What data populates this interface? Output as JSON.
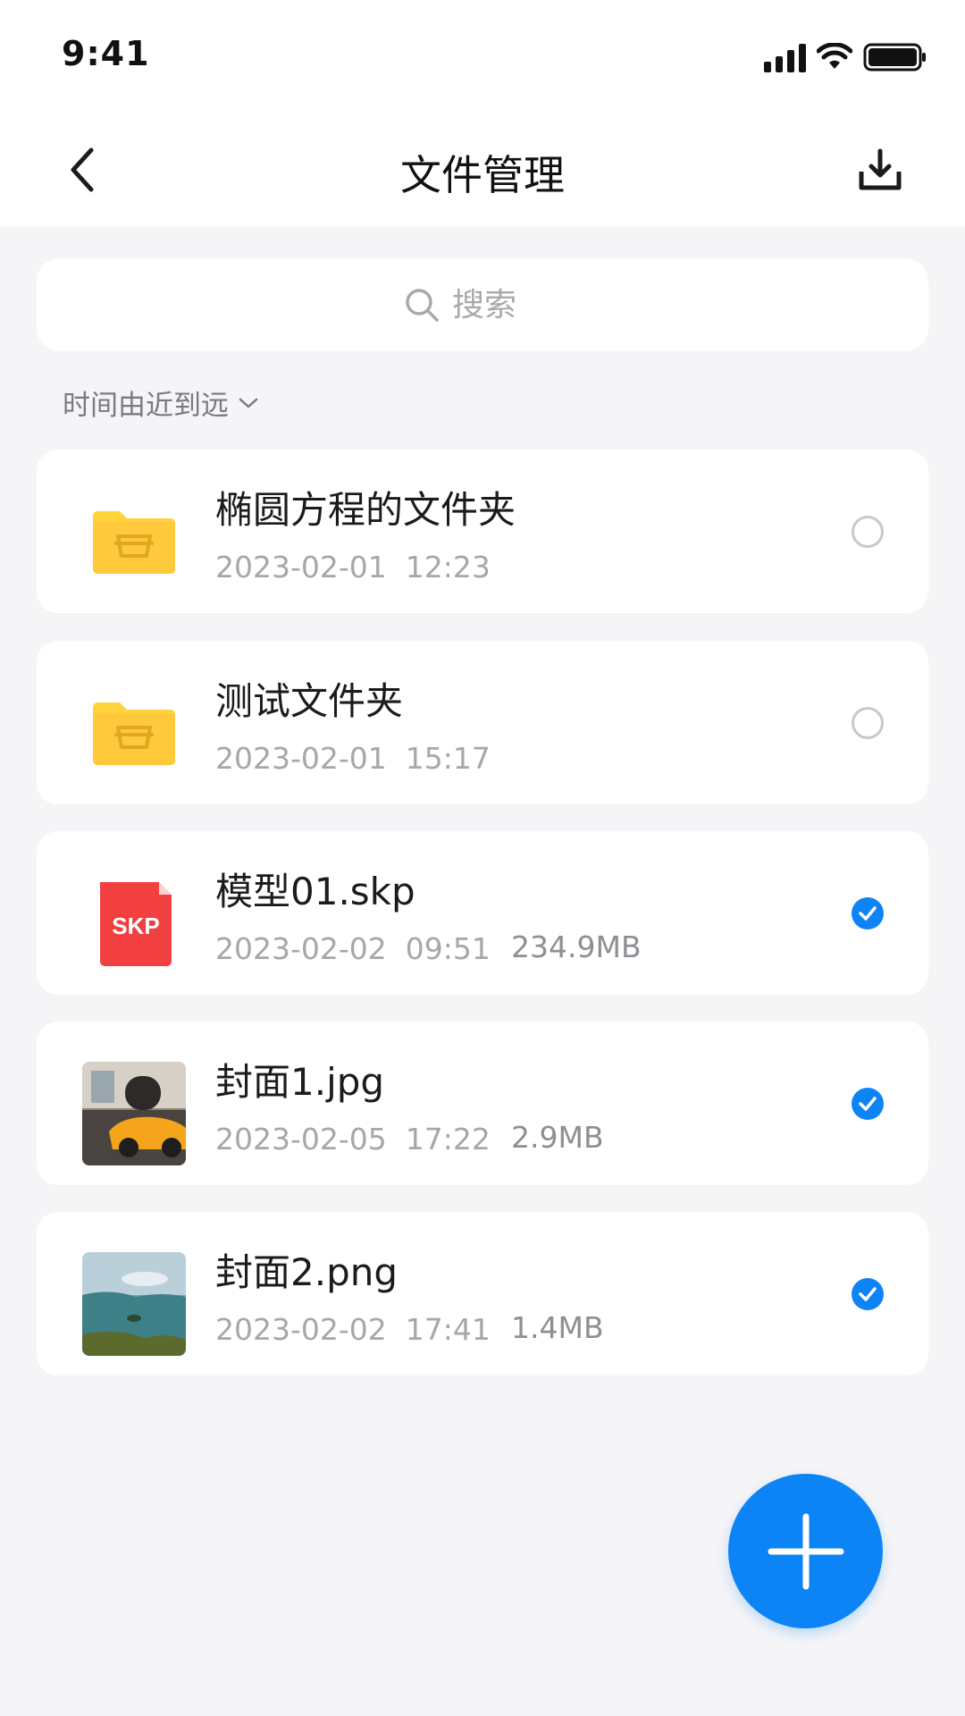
{
  "status_bar": {
    "time": "9:41"
  },
  "header": {
    "title": "文件管理",
    "back_icon": "chevron-left-icon",
    "download_icon": "download-icon"
  },
  "search": {
    "placeholder": "搜索",
    "value": ""
  },
  "sort": {
    "label": "时间由近到远",
    "icon": "chevron-down-icon"
  },
  "files": [
    {
      "name": "椭圆方程的文件夹",
      "date": "2023-02-01",
      "time": "12:23",
      "size": "",
      "type": "folder",
      "selected": false
    },
    {
      "name": "测试文件夹",
      "date": "2023-02-01",
      "time": "15:17",
      "size": "",
      "type": "folder",
      "selected": false
    },
    {
      "name": "模型01.skp",
      "date": "2023-02-02",
      "time": "09:51",
      "size": "234.9MB",
      "type": "skp",
      "badge": "SKP",
      "selected": true
    },
    {
      "name": "封面1.jpg",
      "date": "2023-02-05",
      "time": "17:22",
      "size": "2.9MB",
      "type": "image",
      "selected": true
    },
    {
      "name": "封面2.png",
      "date": "2023-02-02",
      "time": "17:41",
      "size": "1.4MB",
      "type": "image",
      "selected": true
    }
  ],
  "fab": {
    "icon": "plus-icon"
  },
  "colors": {
    "accent": "#0d84f5",
    "folder": "#fdd23a",
    "skp": "#f1403f",
    "background": "#f5f5f7"
  }
}
